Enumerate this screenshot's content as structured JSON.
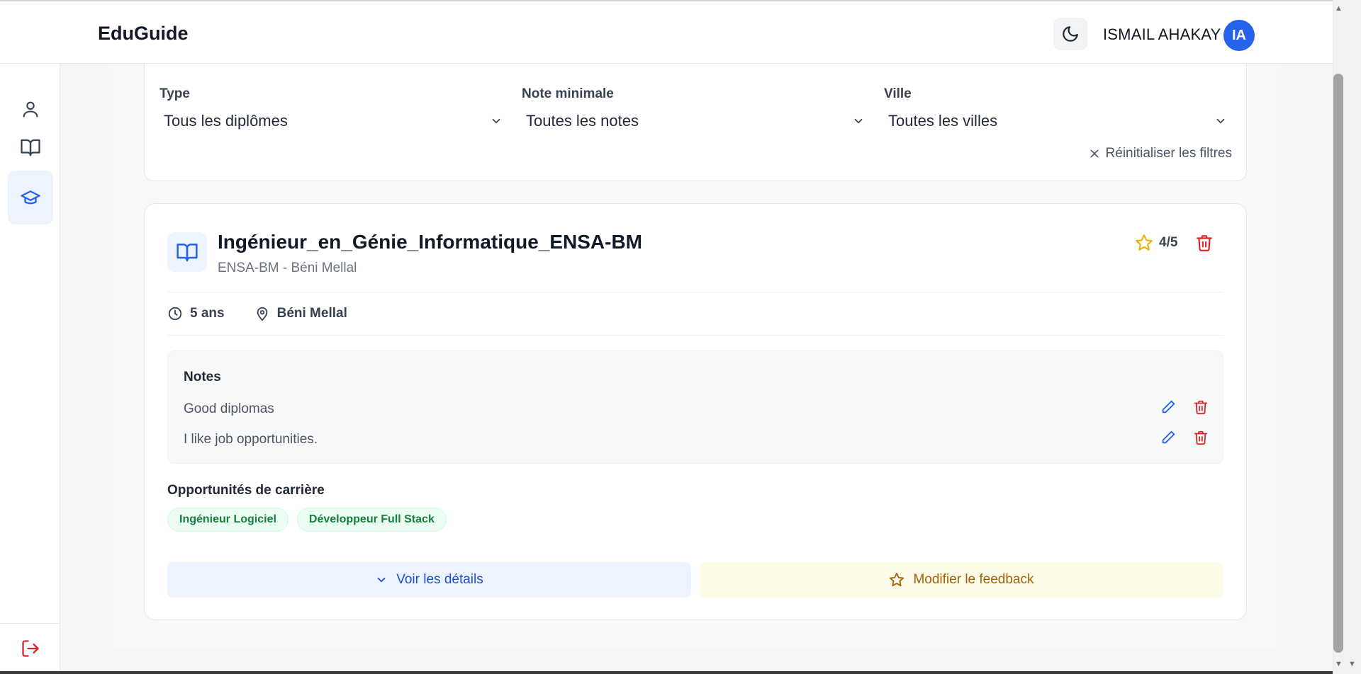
{
  "header": {
    "brand": "EduGuide",
    "user_name": "ISMAIL AHAKAY",
    "user_initials": "IA"
  },
  "sidebar": {
    "items": [
      {
        "name": "profile",
        "icon": "user-icon"
      },
      {
        "name": "formations",
        "icon": "book-open-icon"
      },
      {
        "name": "diplomas",
        "icon": "graduation-cap-icon",
        "active": true
      }
    ],
    "logout_icon": "logout-icon"
  },
  "filters": {
    "type": {
      "label": "Type",
      "value": "Tous les diplômes"
    },
    "min_rating": {
      "label": "Note minimale",
      "value": "Toutes les notes"
    },
    "city": {
      "label": "Ville",
      "value": "Toutes les villes"
    },
    "reset_label": "Réinitialiser les filtres"
  },
  "diploma": {
    "title": "Ingénieur_en_Génie_Informatique_ENSA-BM",
    "subtitle": "ENSA-BM - Béni Mellal",
    "rating": "4/5",
    "duration": "5 ans",
    "city": "Béni Mellal",
    "notes_title": "Notes",
    "notes": [
      {
        "text": "Good diplomas"
      },
      {
        "text": "I like job opportunities."
      }
    ],
    "career_title": "Opportunités de carrière",
    "careers": [
      "Ingénieur Logiciel",
      "Développeur Full Stack"
    ],
    "details_label": "Voir les détails",
    "feedback_label": "Modifier le feedback"
  },
  "colors": {
    "accent": "#2563eb",
    "danger": "#dc2626",
    "star": "#eab308",
    "tag_green": "#15803d"
  }
}
